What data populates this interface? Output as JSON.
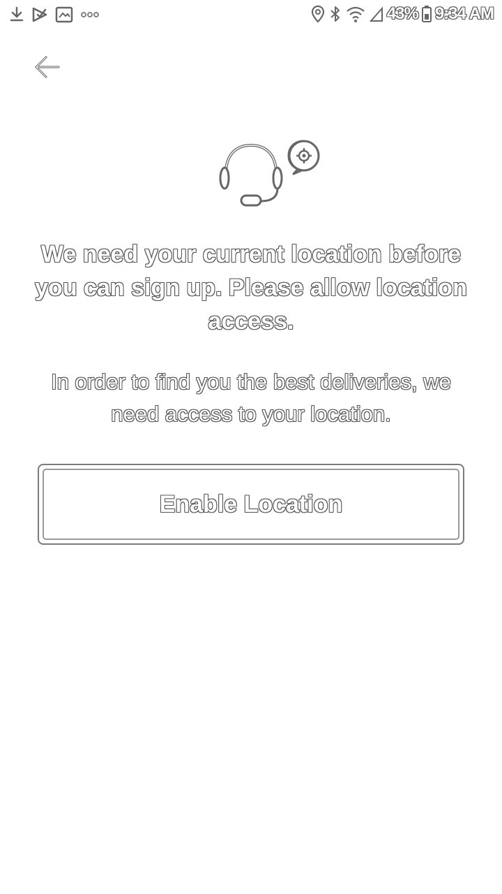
{
  "status_bar": {
    "left_icons": [
      "download-icon",
      "check-message-icon",
      "image-icon",
      "more-dots-icon"
    ],
    "right_icons": [
      "location-pin-icon",
      "bluetooth-icon",
      "wifi-icon",
      "signal-icon",
      "battery-icon"
    ],
    "battery_percent": "43%",
    "time": "9:34 AM"
  },
  "nav": {
    "back_icon": "arrow-left-icon"
  },
  "hero": {
    "icon": "headset-location-icon"
  },
  "content": {
    "heading": "We need your current location before you can sign up. Please allow location access.",
    "subtext": "In order to find you the best deliveries, we need access to your location."
  },
  "actions": {
    "enable_location_label": "Enable Location"
  },
  "colors": {
    "outline": "#555555",
    "background": "#ffffff"
  }
}
